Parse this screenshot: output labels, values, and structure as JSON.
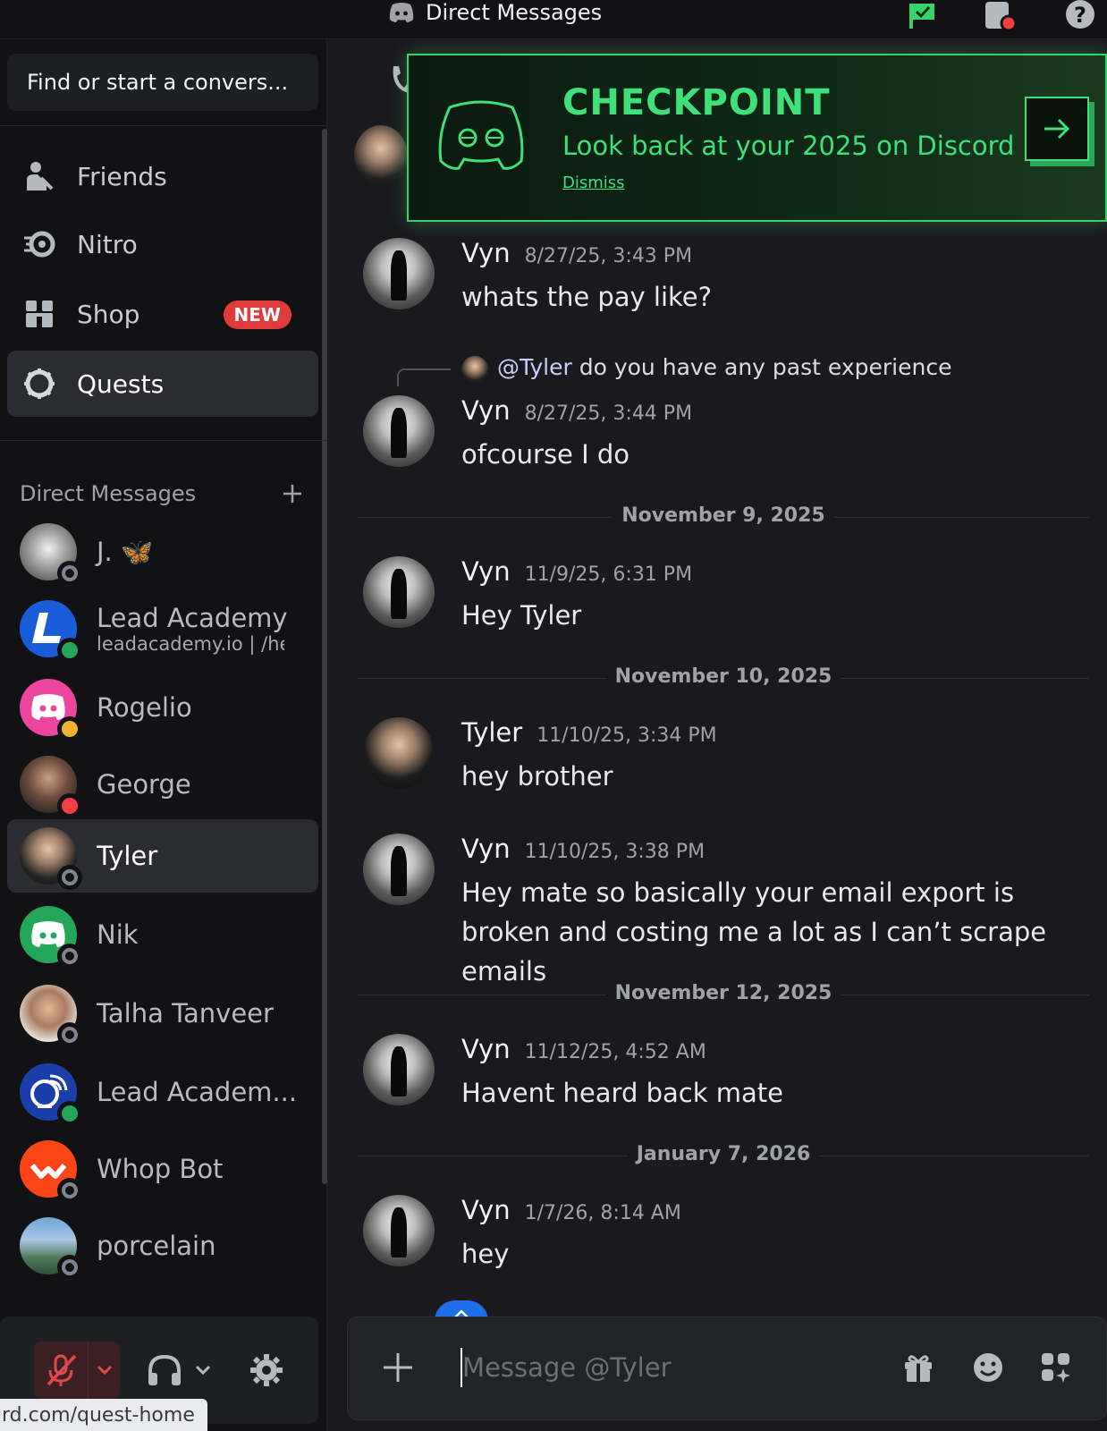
{
  "topbar": {
    "title": "Direct Messages"
  },
  "sidebar": {
    "search_placeholder": "Find or start a convers...",
    "nav": [
      {
        "label": "Friends",
        "icon": "friends-icon"
      },
      {
        "label": "Nitro",
        "icon": "nitro-icon"
      },
      {
        "label": "Shop",
        "icon": "shop-icon",
        "badge": "NEW"
      },
      {
        "label": "Quests",
        "icon": "quests-icon",
        "active": true
      }
    ],
    "dm_header": "Direct Messages",
    "dms": [
      {
        "name": "J. 🦋",
        "status": "offline"
      },
      {
        "name": "Lead Academy",
        "sub": "leadacademy.io | /hel",
        "status": "online"
      },
      {
        "name": "Rogelio",
        "status": "idle"
      },
      {
        "name": "George",
        "status": "dnd"
      },
      {
        "name": "Tyler",
        "status": "offline",
        "active": true
      },
      {
        "name": "Nik",
        "status": "offline"
      },
      {
        "name": "Talha Tanveer",
        "status": "offline"
      },
      {
        "name": "Lead Academ...",
        "status": "online"
      },
      {
        "name": "Whop Bot",
        "status": "offline"
      },
      {
        "name": "porcelain",
        "status": "offline"
      }
    ],
    "tooltip_url": "rd.com/quest-home"
  },
  "banner": {
    "heading": "CHECKPOINT",
    "subtitle": "Look back at your 2025 on Discord",
    "dismiss": "Dismiss"
  },
  "reply": {
    "mention": "@Tyler",
    "text": "do you have any past experience"
  },
  "messages": [
    {
      "author": "Vyn",
      "time": "8/27/25, 3:43 PM",
      "body": "whats the pay like?"
    },
    {
      "author": "Vyn",
      "time": "8/27/25, 3:44 PM",
      "body": "ofcourse I do"
    },
    {
      "author": "Vyn",
      "time": "11/9/25, 6:31 PM",
      "body": "Hey Tyler"
    },
    {
      "author": "Tyler",
      "time": "11/10/25, 3:34 PM",
      "body": "hey brother"
    },
    {
      "author": "Vyn",
      "time": "11/10/25, 3:38 PM",
      "body": "Hey mate so basically your email export is broken and costing me a lot as I can’t scrape emails"
    },
    {
      "author": "Vyn",
      "time": "11/12/25, 4:52 AM",
      "body": "Havent heard back mate"
    },
    {
      "author": "Vyn",
      "time": "1/7/26, 8:14 AM",
      "body": "hey"
    }
  ],
  "dividers": [
    "November 9, 2025",
    "November 10, 2025",
    "November 12, 2025",
    "January 7, 2026"
  ],
  "composer": {
    "placeholder": "Message @Tyler"
  },
  "colors": {
    "accent_green": "#3fe07a",
    "online": "#23a55a",
    "idle": "#f0b232",
    "dnd": "#f23f43",
    "offline": "#80848e",
    "blurple": "#5865f2"
  }
}
